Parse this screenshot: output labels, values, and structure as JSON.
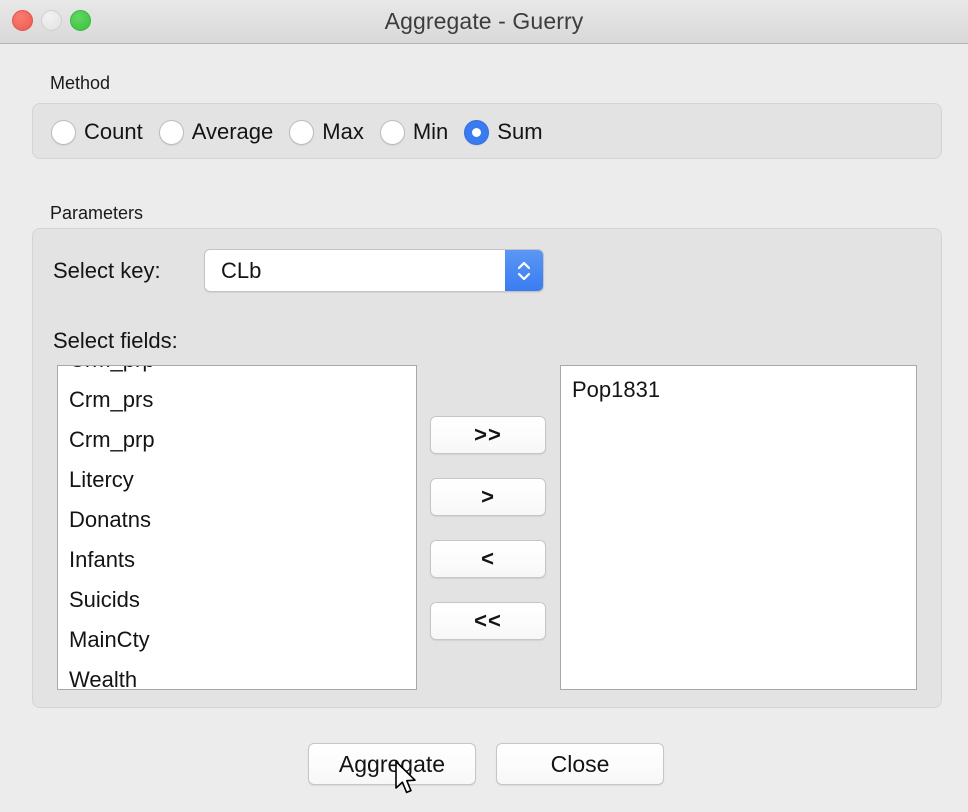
{
  "window": {
    "title": "Aggregate - Guerry",
    "traffic_lights": [
      {
        "name": "close",
        "color": "#f0655b"
      },
      {
        "name": "minimize",
        "color": "#e6e6e6"
      },
      {
        "name": "maximize",
        "color": "#44c846"
      }
    ]
  },
  "method": {
    "group_label": "Method",
    "selected": "Sum",
    "options": [
      {
        "label": "Count",
        "checked": false
      },
      {
        "label": "Average",
        "checked": false
      },
      {
        "label": "Max",
        "checked": false
      },
      {
        "label": "Min",
        "checked": false
      },
      {
        "label": "Sum",
        "checked": true
      }
    ],
    "accent_color": "#3a7cf0"
  },
  "parameters": {
    "group_label": "Parameters",
    "select_key_label": "Select key:",
    "select_key_value": "CLb",
    "select_fields_label": "Select fields:",
    "available_fields": [
      "Crm_prp",
      "Crm_prs",
      "Crm_prp",
      "Litercy",
      "Donatns",
      "Infants",
      "Suicids",
      "MainCty",
      "Wealth"
    ],
    "selected_fields": [
      "Pop1831"
    ],
    "transfer_buttons": [
      {
        "name": "move-all-right",
        "label": ">>"
      },
      {
        "name": "move-right",
        "label": ">"
      },
      {
        "name": "move-left",
        "label": "<"
      },
      {
        "name": "move-all-left",
        "label": "<<"
      }
    ]
  },
  "actions": {
    "aggregate_label": "Aggregate",
    "close_label": "Close"
  }
}
